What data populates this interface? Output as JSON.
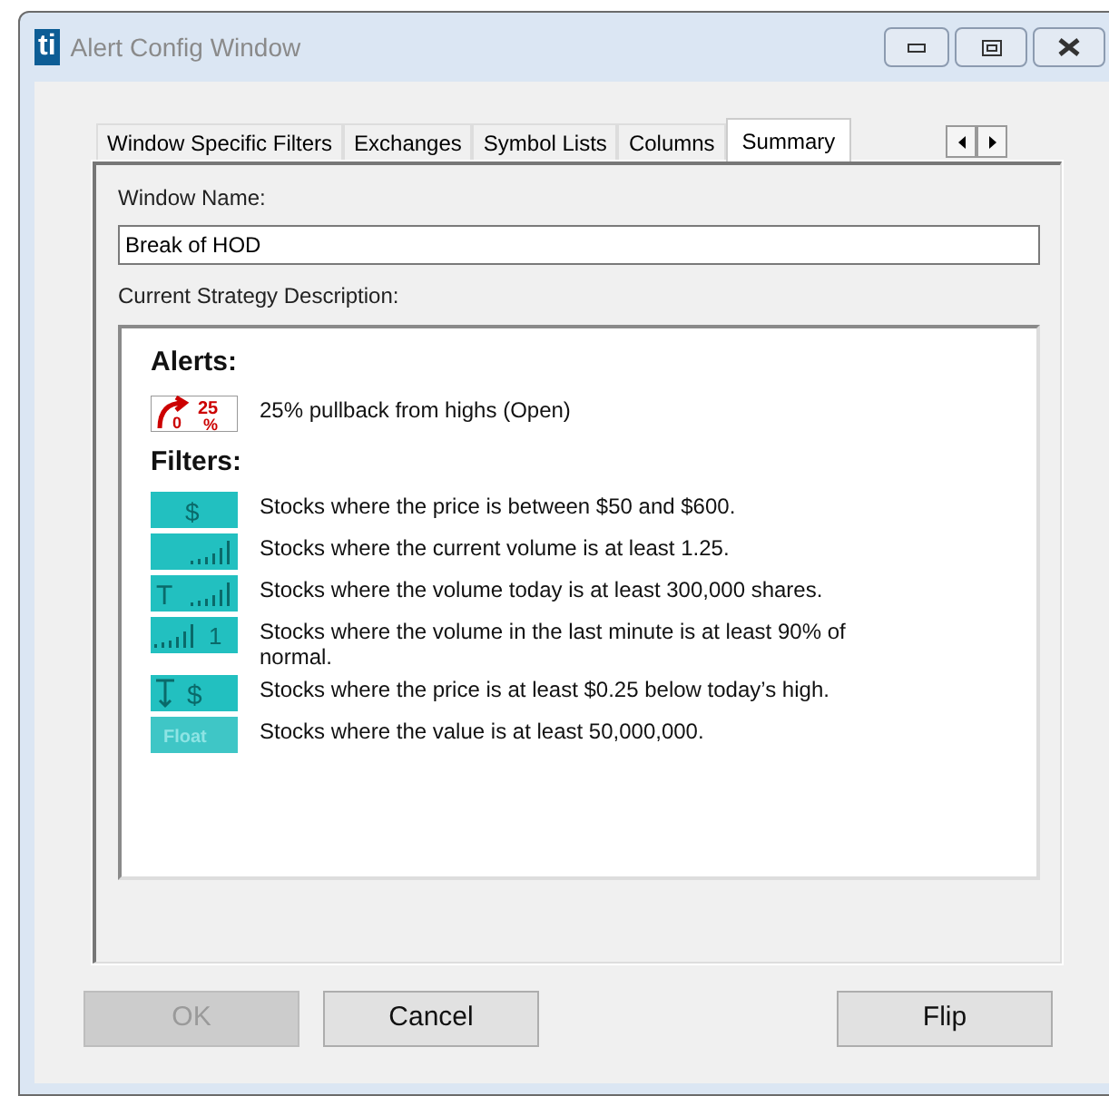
{
  "window": {
    "logo": "ti",
    "title": "Alert Config Window"
  },
  "tabs": [
    {
      "label": "Window Specific Filters",
      "selected": false
    },
    {
      "label": "Exchanges",
      "selected": false
    },
    {
      "label": "Symbol Lists",
      "selected": false
    },
    {
      "label": "Columns",
      "selected": false
    },
    {
      "label": "Summary",
      "selected": true
    }
  ],
  "window_name": {
    "label": "Window Name:",
    "value": "Break of HOD"
  },
  "description": {
    "label": "Current Strategy Description:",
    "alerts_heading": "Alerts:",
    "alerts": [
      {
        "kind": "pullback",
        "icon_text": [
          "0",
          "25",
          "%"
        ],
        "text": "25% pullback from highs (Open)"
      }
    ],
    "filters_heading": "Filters:",
    "filters": [
      {
        "kind": "price",
        "icon_text": "$",
        "text": "Stocks where the price is between $50 and $600."
      },
      {
        "kind": "volume",
        "text": "Stocks where the current volume is at least 1.25."
      },
      {
        "kind": "volume-today",
        "icon_text": "T",
        "text": "Stocks where the volume today is at least 300,000 shares."
      },
      {
        "kind": "volume-minute",
        "icon_text": "1",
        "text": "Stocks where the volume in the last minute is at least 90% of normal."
      },
      {
        "kind": "below-high",
        "icon_text": "$",
        "text": "Stocks where the price is at least $0.25 below today’s high."
      },
      {
        "kind": "float",
        "icon_text": "Float",
        "text": "Stocks where the value is at least 50,000,000."
      }
    ]
  },
  "buttons": [
    {
      "label": "OK",
      "disabled": true
    },
    {
      "label": "Cancel",
      "disabled": false
    },
    {
      "label": "Flip",
      "disabled": false
    }
  ]
}
